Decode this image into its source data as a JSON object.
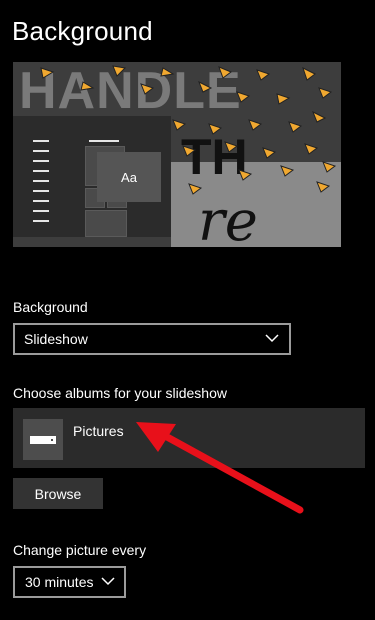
{
  "page": {
    "title": "Background"
  },
  "preview": {
    "wallpaper_text": [
      "HANDLE",
      "TH",
      "re"
    ],
    "tile_label": "Aa"
  },
  "background_setting": {
    "label": "Background",
    "selected": "Slideshow"
  },
  "albums": {
    "label": "Choose albums for your slideshow",
    "items": [
      {
        "name": "Pictures",
        "icon": "drive-icon"
      }
    ],
    "browse_label": "Browse"
  },
  "interval": {
    "label": "Change picture every",
    "selected": "30 minutes"
  },
  "colors": {
    "background": "#000000",
    "card": "#2b2b2b",
    "button": "#333333",
    "border": "#9b9b9b",
    "annotation_arrow": "#e8101a"
  }
}
